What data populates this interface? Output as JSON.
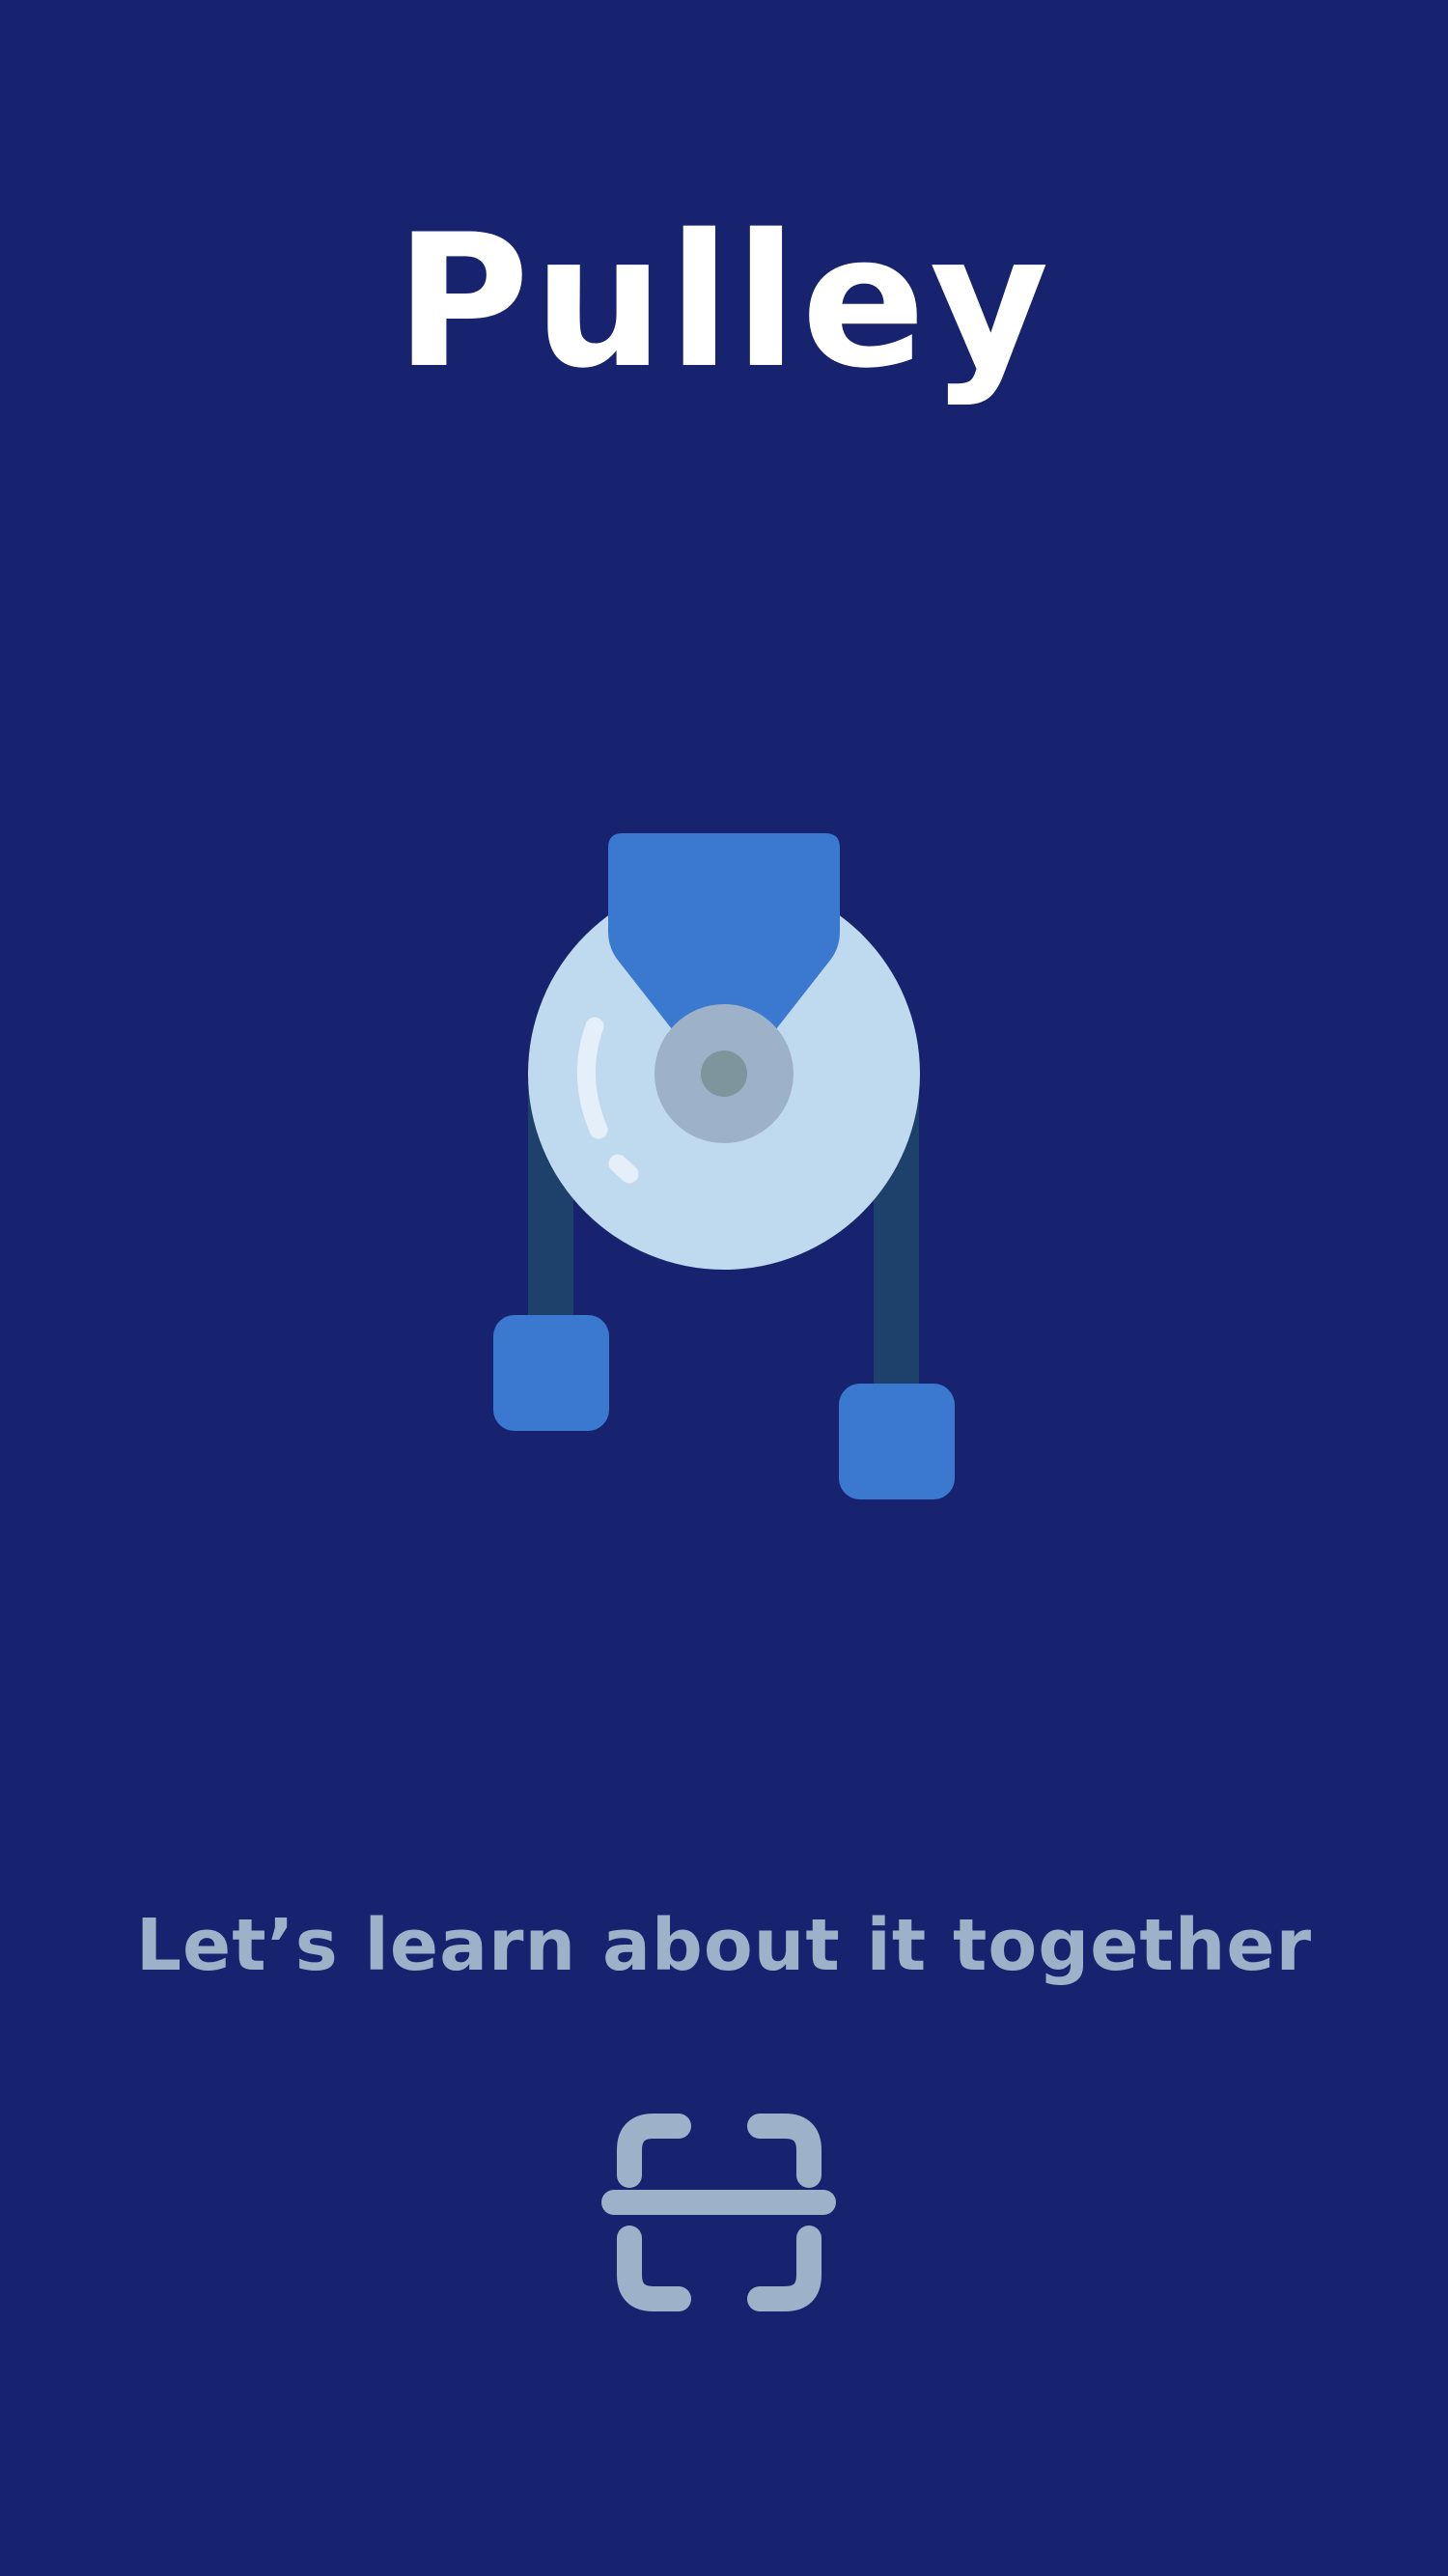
{
  "app": {
    "title": "Pulley"
  },
  "main": {
    "tagline": "Let’s learn about it together",
    "illustration_icon": "pulley-icon",
    "scan_icon": "scan-icon"
  },
  "colors": {
    "background": "#17236e",
    "title": "#ffffff",
    "tagline": "#9db2c8",
    "wheel": "#bfdaef",
    "bracket": "#3b79d1",
    "rope": "#1e416b",
    "hub": "#9db2c8",
    "axle": "#7f959e",
    "scan_icon": "#9db2c8"
  }
}
